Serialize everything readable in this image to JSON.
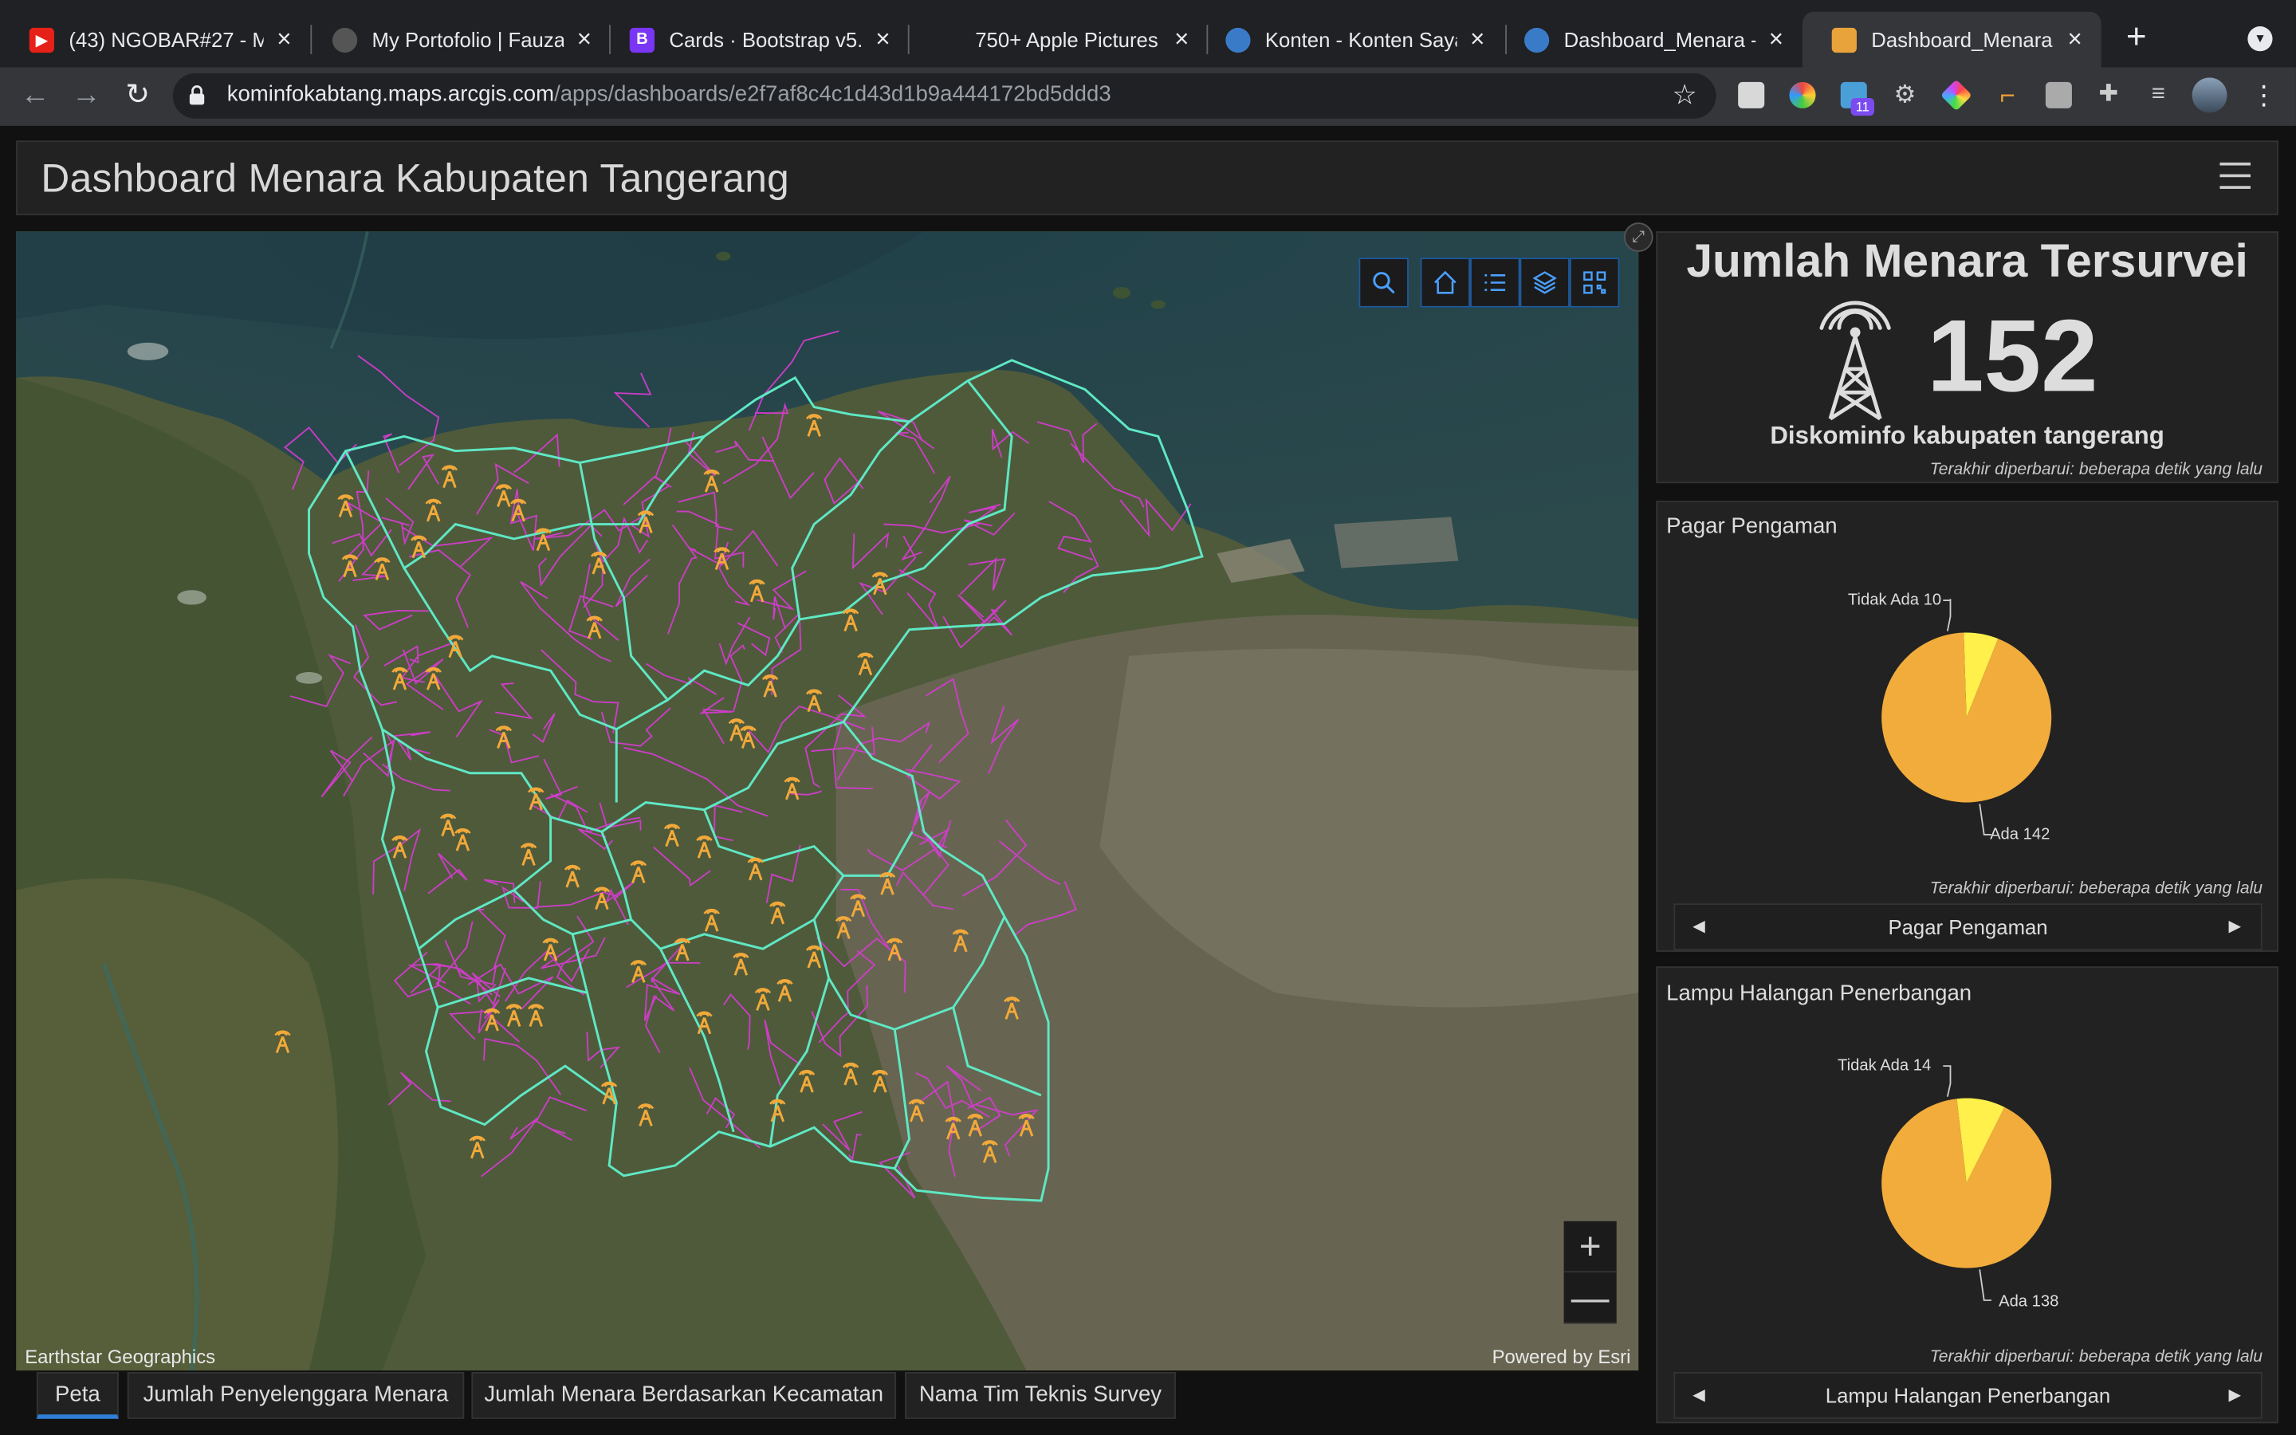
{
  "browser": {
    "tabs": [
      {
        "title": "(43) NGOBAR#27 - M",
        "favicon": "youtube-icon"
      },
      {
        "title": "My Portofolio | Fauzan",
        "favicon": "globe-icon"
      },
      {
        "title": "Cards · Bootstrap v5.",
        "favicon": "bootstrap-icon"
      },
      {
        "title": "750+ Apple Pictures [",
        "favicon": "apple-icon"
      },
      {
        "title": "Konten - Konten Saya",
        "favicon": "arcgis-icon"
      },
      {
        "title": "Dashboard_Menara -",
        "favicon": "arcgis-icon"
      },
      {
        "title": "Dashboard_Menara",
        "favicon": "dashboard-icon"
      }
    ],
    "url_host": "kominfokabtang.maps.arcgis.com",
    "url_path": "/apps/dashboards/e2f7af8c4c1d43d1b9a444172bd5ddd3",
    "extension_badge": "11"
  },
  "dashboard": {
    "title": "Dashboard Menara Kabupaten Tangerang"
  },
  "map": {
    "attribution_left": "Earthstar Geographics",
    "attribution_right": "Powered by Esri",
    "tools": [
      "search-icon",
      "home-icon",
      "legend-icon",
      "layers-icon",
      "qr-icon"
    ],
    "zoom_in": "+",
    "zoom_out": "—"
  },
  "indicator": {
    "title": "Jumlah Menara Tersurvei",
    "value": "152",
    "subtitle": "Diskominfo kabupaten tangerang",
    "updated": "Terakhir diperbarui: beberapa detik yang lalu"
  },
  "pie1": {
    "title": "Pagar Pengaman",
    "label_small": "Tidak Ada 10",
    "label_large": "Ada 142",
    "updated": "Terakhir diperbarui: beberapa detik yang lalu",
    "nav_label": "Pagar Pengaman"
  },
  "pie2": {
    "title": "Lampu Halangan Penerbangan",
    "label_small": "Tidak Ada 14",
    "label_large": "Ada 138",
    "updated": "Terakhir diperbarui: beberapa detik yang lalu",
    "nav_label": "Lampu Halangan Penerbangan"
  },
  "chart_data": [
    {
      "type": "pie",
      "title": "Pagar Pengaman",
      "categories": [
        "Tidak Ada",
        "Ada"
      ],
      "values": [
        10,
        142
      ],
      "colors": [
        "#fff04c",
        "#f2ac3c"
      ]
    },
    {
      "type": "pie",
      "title": "Lampu Halangan Penerbangan",
      "categories": [
        "Tidak Ada",
        "Ada"
      ],
      "values": [
        14,
        138
      ],
      "colors": [
        "#fff04c",
        "#f2ac3c"
      ]
    }
  ],
  "bottom_tabs": [
    "Peta",
    "Jumlah Penyelenggara Menara",
    "Jumlah Menara Berdasarkan Kecamatan",
    "Nama Tim Teknis Survey"
  ],
  "colors": {
    "boundary": "#5fe8c4",
    "village_boundary": "#d43ccf",
    "tower": "#f2a93a",
    "accent": "#2f7fd6"
  }
}
